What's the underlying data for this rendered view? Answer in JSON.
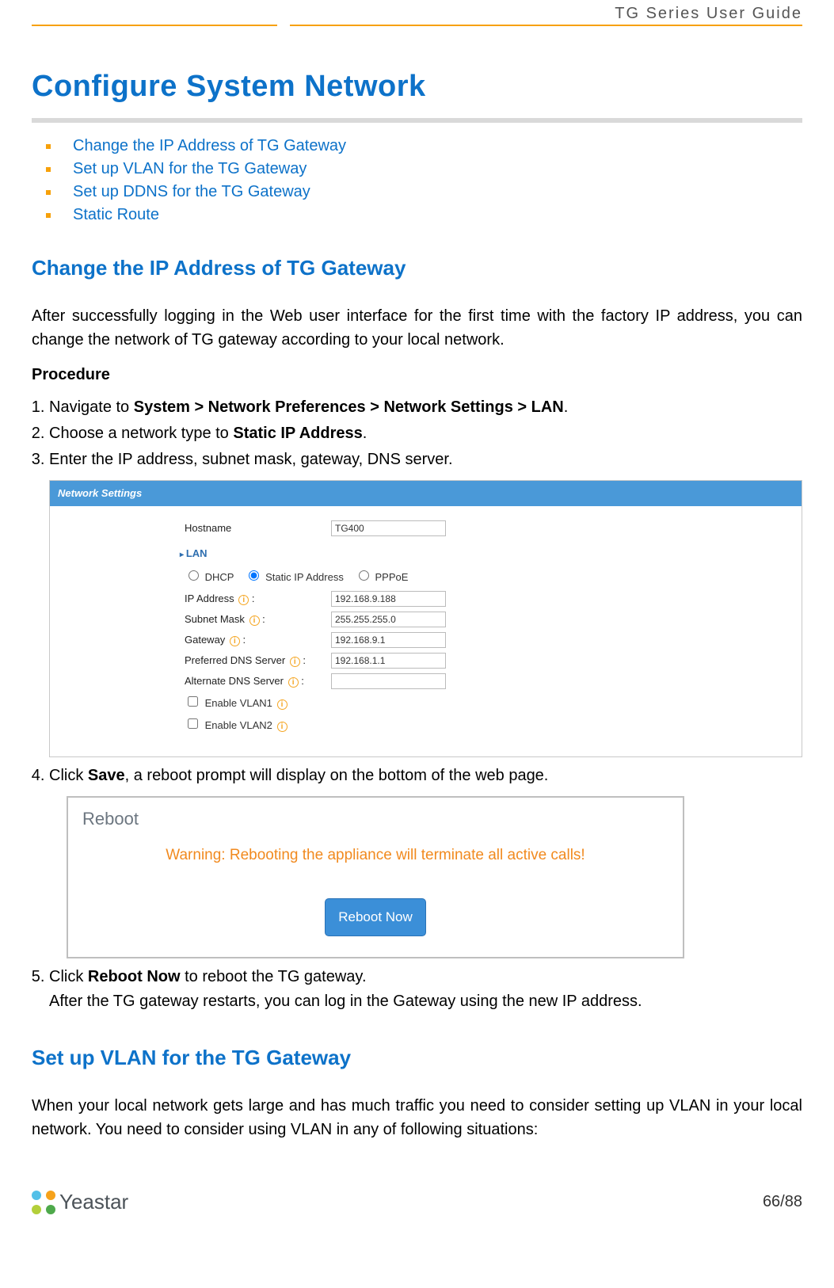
{
  "header": {
    "guide_title": "TG  Series  User  Guide"
  },
  "title": "Configure System Network",
  "toc": [
    "Change the IP Address of TG Gateway",
    "Set up VLAN for the TG Gateway",
    "Set up DDNS for the TG Gateway",
    "Static Route"
  ],
  "section1": {
    "heading": "Change the IP Address of TG Gateway",
    "intro": "After successfully logging in the Web user interface for the first time with the factory IP address, you can change the network of TG gateway according to your local network.",
    "procedure_label": "Procedure",
    "steps": {
      "s1_pre": "Navigate to ",
      "s1_bold": "System > Network Preferences > Network Settings > LAN",
      "s1_post": ".",
      "s2_pre": "Choose a network type to ",
      "s2_bold": "Static IP Address",
      "s2_post": ".",
      "s3": "Enter the IP address, subnet mask, gateway, DNS server.",
      "s4_pre": "Click ",
      "s4_bold": "Save",
      "s4_post": ", a reboot prompt will display on the bottom of the web page.",
      "s5_pre": "Click ",
      "s5_bold": "Reboot Now",
      "s5_post": " to reboot the TG gateway.",
      "s5_after": "After the TG gateway restarts, you can log in the Gateway using the new IP address."
    }
  },
  "shot1": {
    "panel_title": "Network Settings",
    "hostname_label": "Hostname",
    "hostname_value": "TG400",
    "lan_label": "LAN",
    "radio_dhcp": "DHCP",
    "radio_static": "Static IP Address",
    "radio_pppoe": "PPPoE",
    "ip_label": "IP Address",
    "ip_value": "192.168.9.188",
    "mask_label": "Subnet Mask",
    "mask_value": "255.255.255.0",
    "gw_label": "Gateway",
    "gw_value": "192.168.9.1",
    "dns1_label": "Preferred DNS Server",
    "dns1_value": "192.168.1.1",
    "dns2_label": "Alternate DNS Server",
    "dns2_value": "",
    "vlan1_label": "Enable VLAN1",
    "vlan2_label": "Enable VLAN2"
  },
  "shot2": {
    "title": "Reboot",
    "warning": "Warning: Rebooting the appliance will terminate all active calls!",
    "button": "Reboot Now"
  },
  "section2": {
    "heading": "Set up VLAN for the TG Gateway",
    "intro": "When your local network gets large and has much traffic you need to consider setting up VLAN in your local network. You need to consider using VLAN in any of following situations:"
  },
  "footer": {
    "brand": "Yeastar",
    "page": "66/88"
  }
}
